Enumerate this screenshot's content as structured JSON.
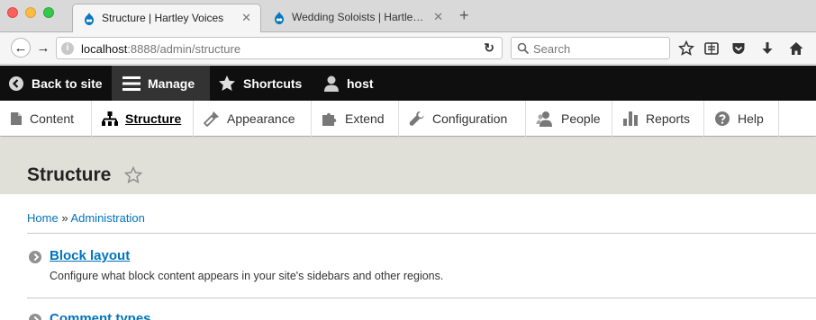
{
  "browser": {
    "tabs": [
      {
        "title": "Structure | Hartley Voices",
        "active": true
      },
      {
        "title": "Wedding Soloists | Hartley Voices",
        "active": false
      }
    ],
    "new_tab_label": "+",
    "close_glyph": "✕",
    "url_host": "localhost",
    "url_rest": ":8888/admin/structure",
    "search_placeholder": "Search"
  },
  "toolbar": {
    "back_label": "Back to site",
    "manage_label": "Manage",
    "shortcuts_label": "Shortcuts",
    "user_label": "host"
  },
  "tray": {
    "items": [
      {
        "label": "Content",
        "icon": "content-icon"
      },
      {
        "label": "Structure",
        "icon": "structure-icon",
        "active": true
      },
      {
        "label": "Appearance",
        "icon": "appearance-icon"
      },
      {
        "label": "Extend",
        "icon": "extend-icon"
      },
      {
        "label": "Configuration",
        "icon": "wrench-icon"
      },
      {
        "label": "People",
        "icon": "people-icon"
      },
      {
        "label": "Reports",
        "icon": "reports-icon"
      },
      {
        "label": "Help",
        "icon": "help-icon"
      }
    ]
  },
  "page": {
    "title": "Structure",
    "breadcrumb": {
      "home": "Home",
      "separator": "»",
      "administration": "Administration"
    }
  },
  "admin_list": [
    {
      "title": "Block layout",
      "description": "Configure what block content appears in your site's sidebars and other regions."
    },
    {
      "title": "Comment types",
      "description": ""
    }
  ],
  "colors": {
    "link": "#0074bd",
    "toolbar_bg": "#0f0f0f",
    "manage_bg": "#333333",
    "header_bg": "#e0e0d8"
  }
}
